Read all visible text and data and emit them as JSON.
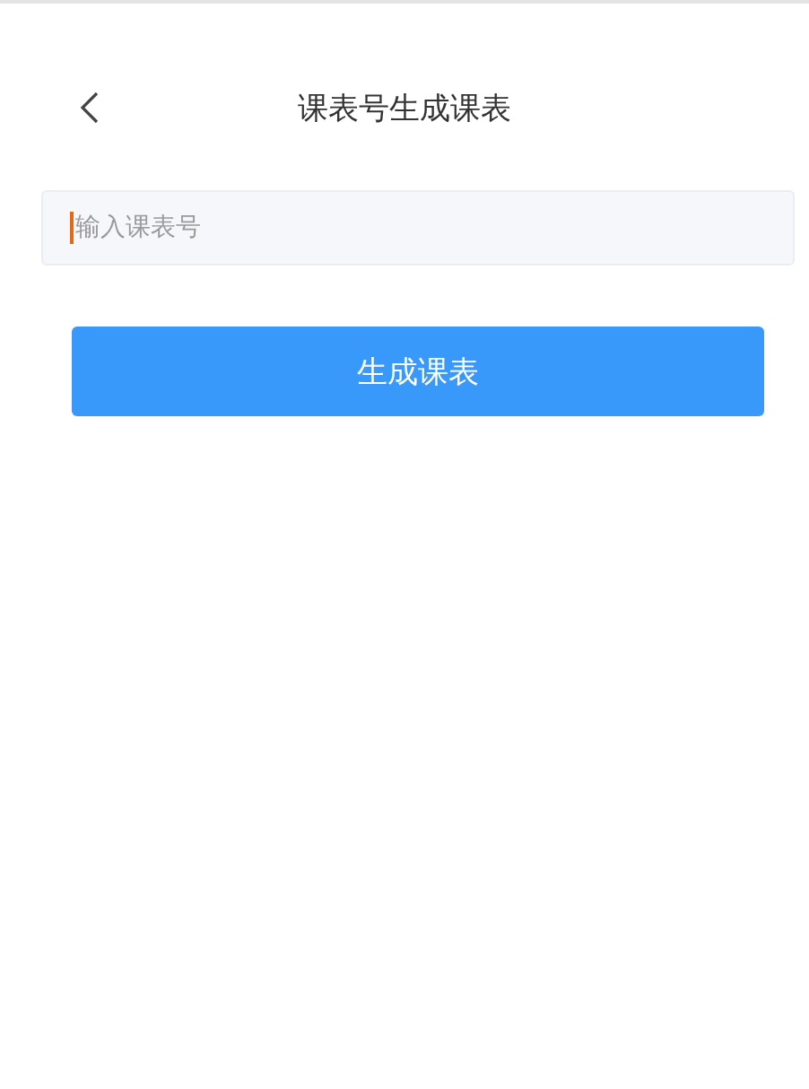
{
  "header": {
    "title": "课表号生成课表"
  },
  "input": {
    "placeholder": "输入课表号"
  },
  "button": {
    "label": "生成课表"
  }
}
